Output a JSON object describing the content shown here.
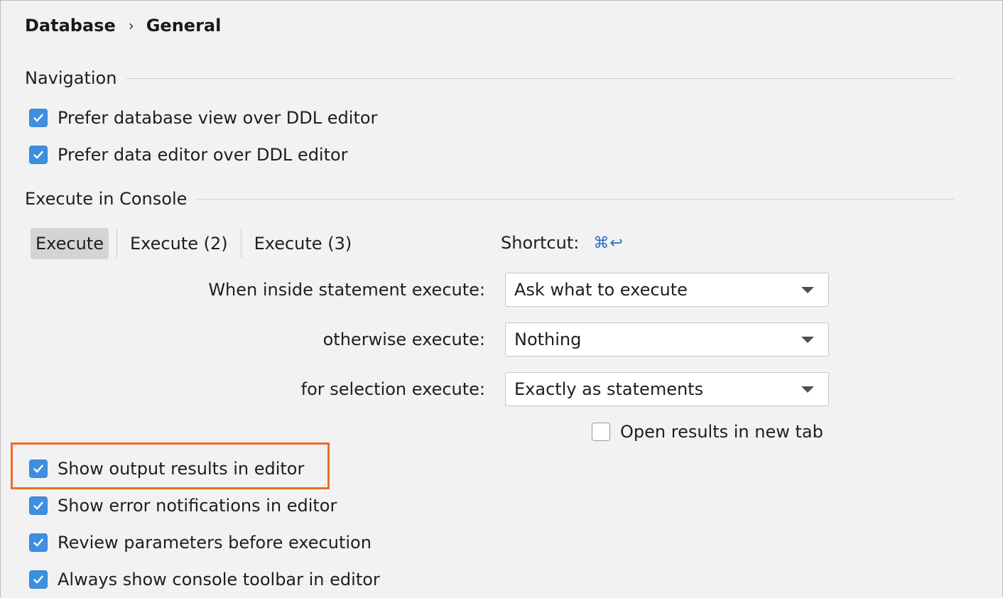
{
  "breadcrumb": {
    "parent": "Database",
    "separator": "›",
    "current": "General"
  },
  "navigation": {
    "title": "Navigation",
    "options": [
      {
        "label": "Prefer database view over DDL editor",
        "checked": true
      },
      {
        "label": "Prefer data editor over DDL editor",
        "checked": true
      }
    ]
  },
  "execute_console": {
    "title": "Execute in Console",
    "tabs": [
      {
        "label": "Execute",
        "selected": true
      },
      {
        "label": "Execute (2)",
        "selected": false
      },
      {
        "label": "Execute (3)",
        "selected": false
      }
    ],
    "shortcut_label": "Shortcut:",
    "shortcut_keys": "⌘↩",
    "inside_statement": {
      "label": "When inside statement execute:",
      "value": "Ask what to execute"
    },
    "otherwise": {
      "label": "otherwise execute:",
      "value": "Nothing"
    },
    "selection": {
      "label": "for selection execute:",
      "value": "Exactly as statements"
    },
    "open_results_new_tab": {
      "label": "Open results in new tab",
      "checked": false
    }
  },
  "editor_options": [
    {
      "label": "Show output results in editor",
      "checked": true,
      "highlighted": true
    },
    {
      "label": "Show error notifications in editor",
      "checked": true
    },
    {
      "label": "Review parameters before execution",
      "checked": true
    },
    {
      "label": "Always show console toolbar in editor",
      "checked": true
    }
  ],
  "colors": {
    "checkbox_checked": "#3d8fe0",
    "highlight_border": "#f06a2a",
    "shortcut_accent": "#2a6fc9",
    "background": "#f2f2f2"
  },
  "icons": {
    "check": "checkmark-icon",
    "dropdown": "chevron-down-icon",
    "breadcrumb_separator": "chevron-right-icon"
  }
}
